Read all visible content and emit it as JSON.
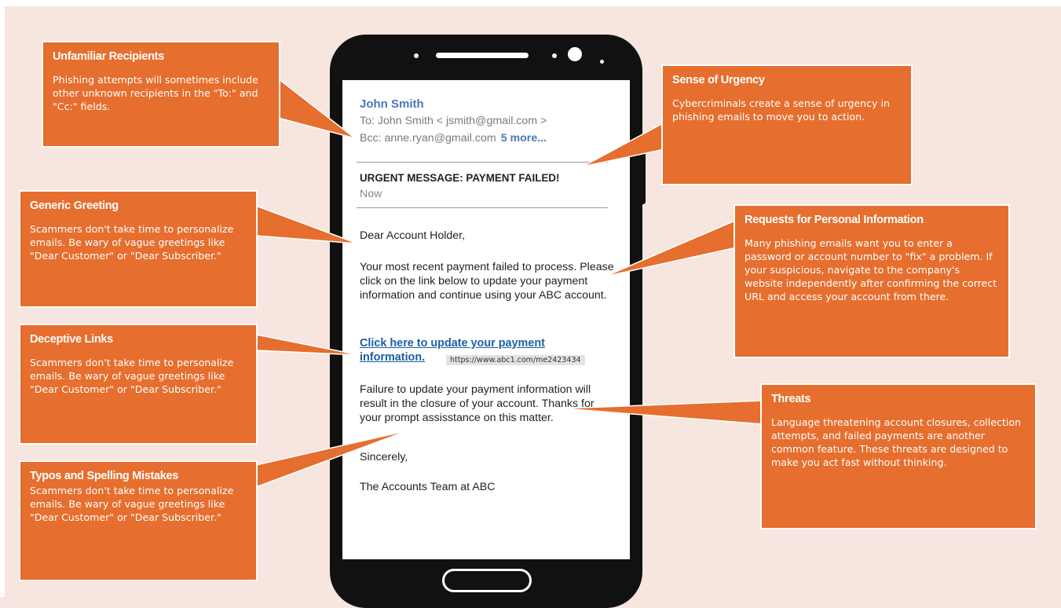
{
  "callouts": {
    "unfamiliar_recipients": {
      "title": "Unfamiliar Recipients",
      "body": "Phishing attempts will sometimes include other unknown recipients in the \"To:\" and \"Cc:\" fields."
    },
    "sense_of_urgency": {
      "title": "Sense of Urgency",
      "body": "Cybercriminals create a sense of urgency in phishing emails to move you to action."
    },
    "generic_greeting": {
      "title": "Generic Greeting",
      "body": "Scammers don't take time to personalize emails. Be wary of vague greetings like \"Dear Customer\" or \"Dear Subscriber.\""
    },
    "personal_information": {
      "title": "Requests for Personal Information",
      "body": "Many phishing emails want you to enter a password or account number to \"fix\" a problem. If your suspicious, navigate to the company's website independently after confirming the correct URL and access your account from there."
    },
    "deceptive_links": {
      "title": "Deceptive Links",
      "body": "Scammers don't take time to personalize emails. Be wary of vague greetings like \"Dear Customer\" or \"Dear Subscriber.\""
    },
    "threats": {
      "title": "Threats",
      "body": "Language threatening account closures, collection attempts, and failed payments are another common feature. These threats are designed to make you act fast without thinking."
    },
    "typos": {
      "title": "Typos and Spelling Mistakes",
      "body": "Scammers don't take time to personalize emails. Be wary of vague greetings like \"Dear Customer\" or \"Dear Subscriber.\""
    }
  },
  "email": {
    "sender": "John Smith",
    "to": "To: John Smith < jsmith@gmail.com >",
    "bcc": "Bcc: anne.ryan@gmail.com",
    "more": "5 more...",
    "subject": "URGENT MESSAGE: PAYMENT FAILED!",
    "time": "Now",
    "greeting": "Dear Account Holder,",
    "paragraph1": "Your most recent payment failed to process. Please click on the  link below to update your payment information and continue using your ABC account.",
    "link_text": "Click here to update your payment information.",
    "url_preview": "https://www.abc1.com/me2423434",
    "paragraph2": "Failure to update your payment information will result in the closure of your account. Thanks for your prompt assisstance on this matter.",
    "closing": "Sincerely,",
    "signature": "The Accounts Team at ABC"
  },
  "colors": {
    "background": "#f7e5df",
    "callout": "#e66e2e",
    "phone": "#111111",
    "sender_blue": "#4a78b5",
    "link_blue": "#1c5fa6"
  }
}
